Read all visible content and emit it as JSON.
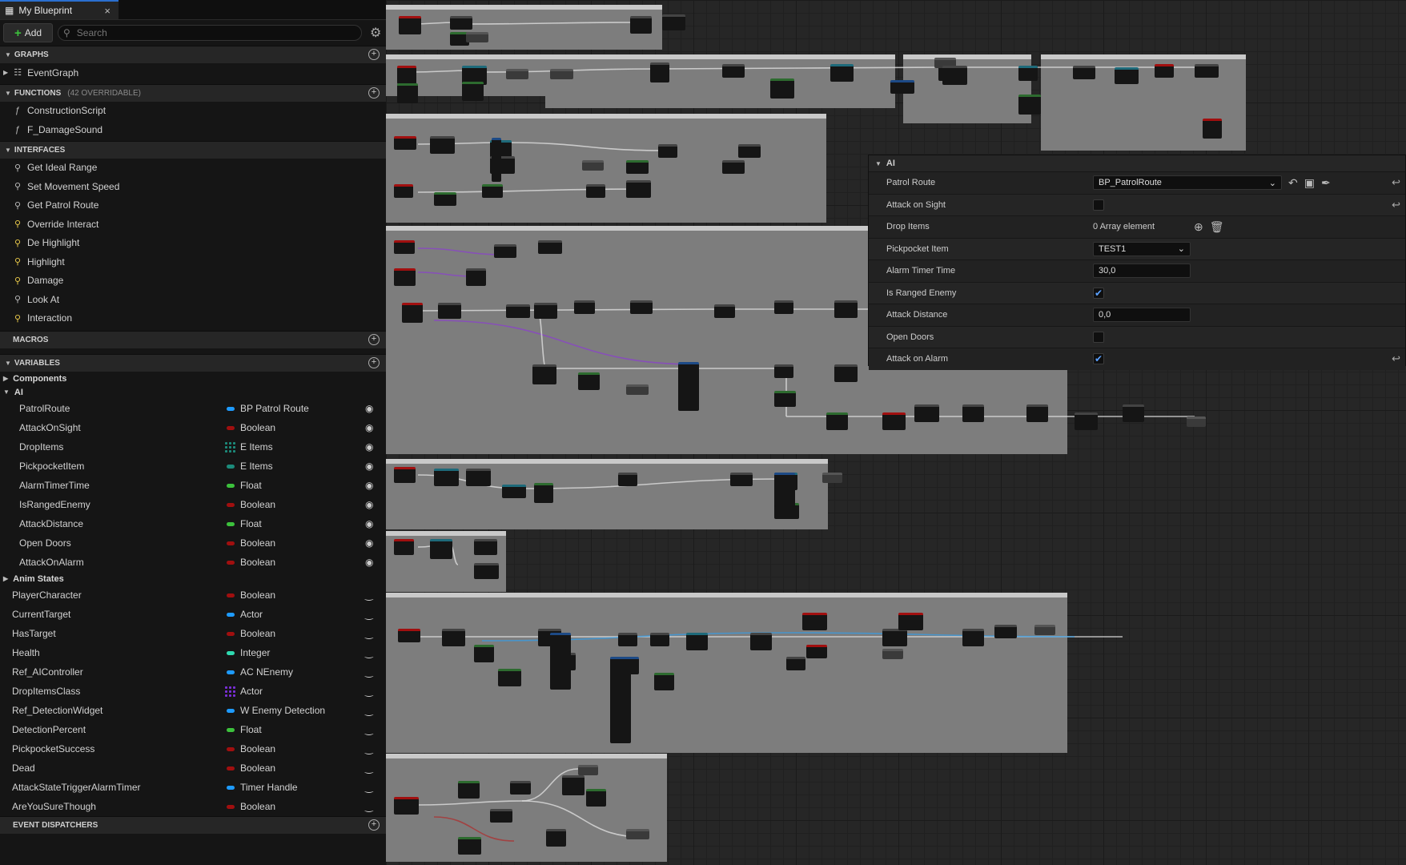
{
  "tab": {
    "title": "My Blueprint",
    "close": "×"
  },
  "toolbar": {
    "add_label": "Add",
    "search_placeholder": "Search"
  },
  "sections": {
    "graphs": "GRAPHS",
    "functions": "FUNCTIONS",
    "functions_sub": "(42 OVERRIDABLE)",
    "interfaces": "INTERFACES",
    "macros": "MACROS",
    "variables": "VARIABLES",
    "event_dispatchers": "EVENT DISPATCHERS"
  },
  "graphs": [
    {
      "label": "EventGraph",
      "icon": "graph-icon"
    }
  ],
  "functions": [
    {
      "label": "ConstructionScript",
      "icon": "function-icon"
    },
    {
      "label": "F_DamageSound",
      "icon": "function-icon"
    }
  ],
  "interfaces": [
    {
      "label": "Get Ideal Range",
      "icon": "interface-icon",
      "yellow": false
    },
    {
      "label": "Set Movement Speed",
      "icon": "interface-icon",
      "yellow": false
    },
    {
      "label": "Get Patrol Route",
      "icon": "interface-icon",
      "yellow": false
    },
    {
      "label": "Override Interact",
      "icon": "interface-event-icon",
      "yellow": true
    },
    {
      "label": "De Highlight",
      "icon": "interface-event-icon",
      "yellow": true
    },
    {
      "label": "Highlight",
      "icon": "interface-event-icon",
      "yellow": true
    },
    {
      "label": "Damage",
      "icon": "interface-event-icon",
      "yellow": true
    },
    {
      "label": "Look At",
      "icon": "interface-icon",
      "yellow": false
    },
    {
      "label": "Interaction",
      "icon": "interface-event-icon",
      "yellow": true
    }
  ],
  "variables": {
    "categories": {
      "components": "Components",
      "ai": "AI",
      "anim_states": "Anim States"
    },
    "ai": [
      {
        "name": "PatrolRoute",
        "type": "BP Patrol Route",
        "color": "#1e9bff",
        "array": false
      },
      {
        "name": "AttackOnSight",
        "type": "Boolean",
        "color": "#a00f0f",
        "array": false
      },
      {
        "name": "DropItems",
        "type": "E Items",
        "color": "#1c8b7b",
        "array": true
      },
      {
        "name": "PickpocketItem",
        "type": "E Items",
        "color": "#1c8b7b",
        "array": false
      },
      {
        "name": "AlarmTimerTime",
        "type": "Float",
        "color": "#3cc13c",
        "array": false
      },
      {
        "name": "IsRangedEnemy",
        "type": "Boolean",
        "color": "#a00f0f",
        "array": false
      },
      {
        "name": "AttackDistance",
        "type": "Float",
        "color": "#3cc13c",
        "array": false
      },
      {
        "name": "Open Doors",
        "type": "Boolean",
        "color": "#a00f0f",
        "array": false
      },
      {
        "name": "AttackOnAlarm",
        "type": "Boolean",
        "color": "#a00f0f",
        "array": false
      }
    ],
    "top": [
      {
        "name": "PlayerCharacter",
        "type": "Boolean",
        "color": "#a00f0f",
        "array": false
      },
      {
        "name": "CurrentTarget",
        "type": "Actor",
        "color": "#1e9bff",
        "array": false
      },
      {
        "name": "HasTarget",
        "type": "Boolean",
        "color": "#a00f0f",
        "array": false
      },
      {
        "name": "Health",
        "type": "Integer",
        "color": "#2fd9b0",
        "array": false
      },
      {
        "name": "Ref_AIController",
        "type": "AC NEnemy",
        "color": "#1e9bff",
        "array": false
      },
      {
        "name": "DropItemsClass",
        "type": "Actor",
        "color": "#7a2fd9",
        "array": true
      },
      {
        "name": "Ref_DetectionWidget",
        "type": "W Enemy Detection",
        "color": "#1e9bff",
        "array": false
      },
      {
        "name": "DetectionPercent",
        "type": "Float",
        "color": "#3cc13c",
        "array": false
      },
      {
        "name": "PickpocketSuccess",
        "type": "Boolean",
        "color": "#a00f0f",
        "array": false
      },
      {
        "name": "Dead",
        "type": "Boolean",
        "color": "#a00f0f",
        "array": false
      },
      {
        "name": "AttackStateTriggerAlarmTimer",
        "type": "Timer Handle",
        "color": "#1e9bff",
        "array": false
      },
      {
        "name": "AreYouSureThough",
        "type": "Boolean",
        "color": "#a00f0f",
        "array": false
      }
    ]
  },
  "details": {
    "header": "AI",
    "patrol_route": {
      "label": "Patrol Route",
      "value": "BP_PatrolRoute"
    },
    "attack_on_sight": {
      "label": "Attack on Sight",
      "checked": false
    },
    "drop_items": {
      "label": "Drop Items",
      "value": "0 Array element"
    },
    "pickpocket_item": {
      "label": "Pickpocket Item",
      "value": "TEST1"
    },
    "alarm_timer_time": {
      "label": "Alarm Timer Time",
      "value": "30,0"
    },
    "is_ranged_enemy": {
      "label": "Is Ranged Enemy",
      "checked": true
    },
    "attack_distance": {
      "label": "Attack Distance",
      "value": "0,0"
    },
    "open_doors": {
      "label": "Open Doors",
      "checked": false
    },
    "attack_on_alarm": {
      "label": "Attack on Alarm",
      "checked": true
    }
  }
}
